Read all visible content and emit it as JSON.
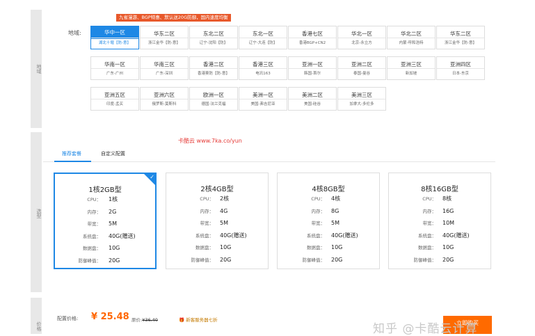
{
  "region": {
    "side_label": "地域",
    "label": "地域:",
    "promo": "九省漫游、BGP特惠、默认送20G防御，国内速度均衡",
    "rows": [
      [
        {
          "zone": "华中一区",
          "sub": "湖北十堰【防-意】",
          "active": true
        },
        {
          "zone": "华东二区",
          "sub": "浙江金华【防-意】"
        },
        {
          "zone": "东北二区",
          "sub": "辽宁-沈阳【防】"
        },
        {
          "zone": "东北一区",
          "sub": "辽宁-大连【防】"
        },
        {
          "zone": "香港七区",
          "sub": "香港BGP+CN2"
        },
        {
          "zone": "华北一区",
          "sub": "北京-永立方"
        },
        {
          "zone": "华北二区",
          "sub": "内蒙-呼和浩特"
        },
        {
          "zone": "华东二区",
          "sub": "浙江金华【防-意】"
        }
      ],
      [
        {
          "zone": "华南一区",
          "sub": "广东-广州"
        },
        {
          "zone": "华南三区",
          "sub": "广东-深圳"
        },
        {
          "zone": "香港二区",
          "sub": "香港葵防【防-意】"
        },
        {
          "zone": "香港三区",
          "sub": "电讯163"
        },
        {
          "zone": "亚洲一区",
          "sub": "韩国-首尔"
        },
        {
          "zone": "亚洲二区",
          "sub": "泰国-曼谷"
        },
        {
          "zone": "亚洲三区",
          "sub": "新加坡"
        },
        {
          "zone": "亚洲四区",
          "sub": "日本-东京"
        }
      ],
      [
        {
          "zone": "亚洲五区",
          "sub": "印度-孟买"
        },
        {
          "zone": "亚洲六区",
          "sub": "俄罗斯-莫斯科"
        },
        {
          "zone": "欧洲一区",
          "sub": "德国-法兰克福"
        },
        {
          "zone": "美洲一区",
          "sub": "美国-弗吉尼亚"
        },
        {
          "zone": "美洲二区",
          "sub": "美国-硅谷"
        },
        {
          "zone": "美洲三区",
          "sub": "加拿大-多伦多"
        }
      ]
    ]
  },
  "selection": {
    "side_label": "选型",
    "watermark": "卡酷云   www.7ka.co/yun",
    "tabs": [
      {
        "label": "推荐套餐",
        "active": true
      },
      {
        "label": "自定义配置",
        "active": false
      }
    ],
    "plans": [
      {
        "name": "1核2GB型",
        "selected": true,
        "rows": [
          {
            "k": "CPU：",
            "v": "1核"
          },
          {
            "k": "内存：",
            "v": "2G"
          },
          {
            "k": "带宽：",
            "v": "5M"
          },
          {
            "k": "系统盘：",
            "v": "40G(赠送)"
          },
          {
            "k": "数据盘：",
            "v": "10G"
          },
          {
            "k": "防御峰值：",
            "v": "20G"
          }
        ]
      },
      {
        "name": "2核4GB型",
        "selected": false,
        "rows": [
          {
            "k": "CPU：",
            "v": "2核"
          },
          {
            "k": "内存：",
            "v": "4G"
          },
          {
            "k": "带宽：",
            "v": "5M"
          },
          {
            "k": "系统盘：",
            "v": "40G(赠送)"
          },
          {
            "k": "数据盘：",
            "v": "10G"
          },
          {
            "k": "防御峰值：",
            "v": "20G"
          }
        ]
      },
      {
        "name": "4核8GB型",
        "selected": false,
        "rows": [
          {
            "k": "CPU：",
            "v": "4核"
          },
          {
            "k": "内存：",
            "v": "8G"
          },
          {
            "k": "带宽：",
            "v": "5M"
          },
          {
            "k": "系统盘：",
            "v": "40G(赠送)"
          },
          {
            "k": "数据盘：",
            "v": "10G"
          },
          {
            "k": "防御峰值：",
            "v": "20G"
          }
        ]
      },
      {
        "name": "8核16GB型",
        "selected": false,
        "rows": [
          {
            "k": "CPU：",
            "v": "8核"
          },
          {
            "k": "内存：",
            "v": "16G"
          },
          {
            "k": "带宽：",
            "v": "10M"
          },
          {
            "k": "系统盘：",
            "v": "40G(赠送)"
          },
          {
            "k": "数据盘：",
            "v": "10G"
          },
          {
            "k": "防御峰值：",
            "v": "20G"
          }
        ]
      }
    ]
  },
  "price": {
    "side_label": "价格",
    "label": "配置价格:",
    "value": "¥ 25.48",
    "orig_label": "原价:",
    "orig_value": "¥36.40",
    "promo": "新客服务器七折",
    "buy_label": "立即购买"
  },
  "overlay": {
    "text": "知乎 @卡酷云计算"
  },
  "colors": {
    "accent": "#1e88e5",
    "price": "#ff6600",
    "buy": "#ff6a00",
    "promo_bg": "#e8582a"
  }
}
